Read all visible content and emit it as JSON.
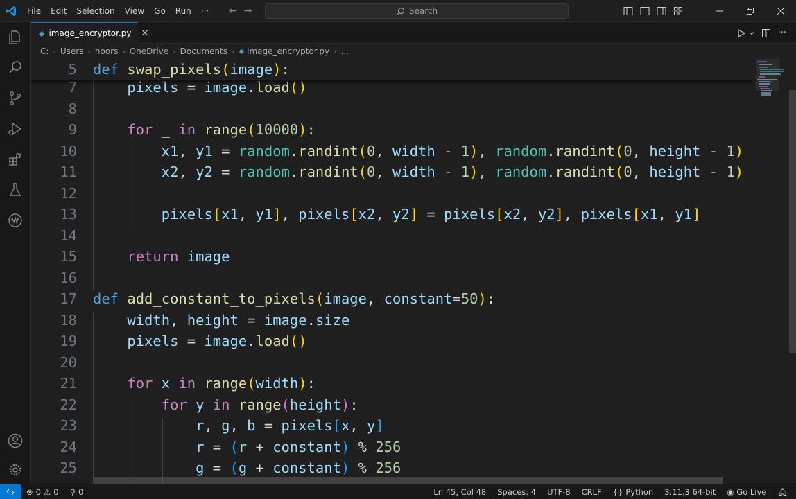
{
  "menu": [
    "File",
    "Edit",
    "Selection",
    "View",
    "Go",
    "Run",
    "···"
  ],
  "search": {
    "placeholder": "Search"
  },
  "tab": {
    "filename": "image_encryptor.py",
    "close": "✕"
  },
  "breadcrumb": [
    "C:",
    "Users",
    "noors",
    "OneDrive",
    "Documents",
    "image_encryptor.py",
    "..."
  ],
  "code_lines": [
    {
      "n": "5",
      "tokens": [
        [
          "kw",
          "def"
        ],
        [
          "op",
          " "
        ],
        [
          "fn",
          "swap_pixels"
        ],
        [
          "p1",
          "("
        ],
        [
          "var",
          "image"
        ],
        [
          "p1",
          ")"
        ],
        [
          "op",
          ":"
        ]
      ]
    },
    {
      "n": "7",
      "tokens": [
        [
          "op",
          "    "
        ],
        [
          "var",
          "pixels"
        ],
        [
          "op",
          " = "
        ],
        [
          "var",
          "image"
        ],
        [
          "op",
          "."
        ],
        [
          "fn",
          "load"
        ],
        [
          "p1",
          "()"
        ]
      ]
    },
    {
      "n": "8",
      "tokens": []
    },
    {
      "n": "9",
      "tokens": [
        [
          "op",
          "    "
        ],
        [
          "kw2",
          "for"
        ],
        [
          "op",
          " "
        ],
        [
          "var",
          "_"
        ],
        [
          "op",
          " "
        ],
        [
          "kw2",
          "in"
        ],
        [
          "op",
          " "
        ],
        [
          "fn",
          "range"
        ],
        [
          "p1",
          "("
        ],
        [
          "num",
          "10000"
        ],
        [
          "p1",
          ")"
        ],
        [
          "op",
          ":"
        ]
      ]
    },
    {
      "n": "10",
      "tokens": [
        [
          "op",
          "        "
        ],
        [
          "var",
          "x1"
        ],
        [
          "op",
          ", "
        ],
        [
          "var",
          "y1"
        ],
        [
          "op",
          " = "
        ],
        [
          "cls",
          "random"
        ],
        [
          "op",
          "."
        ],
        [
          "fn",
          "randint"
        ],
        [
          "p1",
          "("
        ],
        [
          "num",
          "0"
        ],
        [
          "op",
          ", "
        ],
        [
          "var",
          "width"
        ],
        [
          "op",
          " - "
        ],
        [
          "num",
          "1"
        ],
        [
          "p1",
          ")"
        ],
        [
          "op",
          ", "
        ],
        [
          "cls",
          "random"
        ],
        [
          "op",
          "."
        ],
        [
          "fn",
          "randint"
        ],
        [
          "p1",
          "("
        ],
        [
          "num",
          "0"
        ],
        [
          "op",
          ", "
        ],
        [
          "var",
          "height"
        ],
        [
          "op",
          " - "
        ],
        [
          "num",
          "1"
        ],
        [
          "p1",
          ")"
        ]
      ]
    },
    {
      "n": "11",
      "tokens": [
        [
          "op",
          "        "
        ],
        [
          "var",
          "x2"
        ],
        [
          "op",
          ", "
        ],
        [
          "var",
          "y2"
        ],
        [
          "op",
          " = "
        ],
        [
          "cls",
          "random"
        ],
        [
          "op",
          "."
        ],
        [
          "fn",
          "randint"
        ],
        [
          "p1",
          "("
        ],
        [
          "num",
          "0"
        ],
        [
          "op",
          ", "
        ],
        [
          "var",
          "width"
        ],
        [
          "op",
          " - "
        ],
        [
          "num",
          "1"
        ],
        [
          "p1",
          ")"
        ],
        [
          "op",
          ", "
        ],
        [
          "cls",
          "random"
        ],
        [
          "op",
          "."
        ],
        [
          "fn",
          "randint"
        ],
        [
          "p1",
          "("
        ],
        [
          "num",
          "0"
        ],
        [
          "op",
          ", "
        ],
        [
          "var",
          "height"
        ],
        [
          "op",
          " - "
        ],
        [
          "num",
          "1"
        ],
        [
          "p1",
          ")"
        ]
      ]
    },
    {
      "n": "12",
      "tokens": []
    },
    {
      "n": "13",
      "tokens": [
        [
          "op",
          "        "
        ],
        [
          "var",
          "pixels"
        ],
        [
          "p1",
          "["
        ],
        [
          "var",
          "x1"
        ],
        [
          "op",
          ", "
        ],
        [
          "var",
          "y1"
        ],
        [
          "p1",
          "]"
        ],
        [
          "op",
          ", "
        ],
        [
          "var",
          "pixels"
        ],
        [
          "p1",
          "["
        ],
        [
          "var",
          "x2"
        ],
        [
          "op",
          ", "
        ],
        [
          "var",
          "y2"
        ],
        [
          "p1",
          "]"
        ],
        [
          "op",
          " = "
        ],
        [
          "var",
          "pixels"
        ],
        [
          "p1",
          "["
        ],
        [
          "var",
          "x2"
        ],
        [
          "op",
          ", "
        ],
        [
          "var",
          "y2"
        ],
        [
          "p1",
          "]"
        ],
        [
          "op",
          ", "
        ],
        [
          "var",
          "pixels"
        ],
        [
          "p1",
          "["
        ],
        [
          "var",
          "x1"
        ],
        [
          "op",
          ", "
        ],
        [
          "var",
          "y1"
        ],
        [
          "p1",
          "]"
        ]
      ]
    },
    {
      "n": "14",
      "tokens": []
    },
    {
      "n": "15",
      "tokens": [
        [
          "op",
          "    "
        ],
        [
          "kw2",
          "return"
        ],
        [
          "op",
          " "
        ],
        [
          "var",
          "image"
        ]
      ]
    },
    {
      "n": "16",
      "tokens": []
    },
    {
      "n": "17",
      "tokens": [
        [
          "kw",
          "def"
        ],
        [
          "op",
          " "
        ],
        [
          "fn",
          "add_constant_to_pixels"
        ],
        [
          "p1",
          "("
        ],
        [
          "var",
          "image"
        ],
        [
          "op",
          ", "
        ],
        [
          "var",
          "constant"
        ],
        [
          "op",
          "="
        ],
        [
          "num",
          "50"
        ],
        [
          "p1",
          ")"
        ],
        [
          "op",
          ":"
        ]
      ]
    },
    {
      "n": "18",
      "tokens": [
        [
          "op",
          "    "
        ],
        [
          "var",
          "width"
        ],
        [
          "op",
          ", "
        ],
        [
          "var",
          "height"
        ],
        [
          "op",
          " = "
        ],
        [
          "var",
          "image"
        ],
        [
          "op",
          "."
        ],
        [
          "var",
          "size"
        ]
      ]
    },
    {
      "n": "19",
      "tokens": [
        [
          "op",
          "    "
        ],
        [
          "var",
          "pixels"
        ],
        [
          "op",
          " = "
        ],
        [
          "var",
          "image"
        ],
        [
          "op",
          "."
        ],
        [
          "fn",
          "load"
        ],
        [
          "p1",
          "()"
        ]
      ]
    },
    {
      "n": "20",
      "tokens": []
    },
    {
      "n": "21",
      "tokens": [
        [
          "op",
          "    "
        ],
        [
          "kw2",
          "for"
        ],
        [
          "op",
          " "
        ],
        [
          "var",
          "x"
        ],
        [
          "op",
          " "
        ],
        [
          "kw2",
          "in"
        ],
        [
          "op",
          " "
        ],
        [
          "fn",
          "range"
        ],
        [
          "p1",
          "("
        ],
        [
          "var",
          "width"
        ],
        [
          "p1",
          ")"
        ],
        [
          "op",
          ":"
        ]
      ]
    },
    {
      "n": "22",
      "tokens": [
        [
          "op",
          "        "
        ],
        [
          "kw2",
          "for"
        ],
        [
          "op",
          " "
        ],
        [
          "var",
          "y"
        ],
        [
          "op",
          " "
        ],
        [
          "kw2",
          "in"
        ],
        [
          "op",
          " "
        ],
        [
          "fn",
          "range"
        ],
        [
          "p2",
          "("
        ],
        [
          "var",
          "height"
        ],
        [
          "p2",
          ")"
        ],
        [
          "op",
          ":"
        ]
      ]
    },
    {
      "n": "23",
      "tokens": [
        [
          "op",
          "            "
        ],
        [
          "var",
          "r"
        ],
        [
          "op",
          ", "
        ],
        [
          "var",
          "g"
        ],
        [
          "op",
          ", "
        ],
        [
          "var",
          "b"
        ],
        [
          "op",
          " = "
        ],
        [
          "var",
          "pixels"
        ],
        [
          "p3",
          "["
        ],
        [
          "var",
          "x"
        ],
        [
          "op",
          ", "
        ],
        [
          "var",
          "y"
        ],
        [
          "p3",
          "]"
        ]
      ]
    },
    {
      "n": "24",
      "tokens": [
        [
          "op",
          "            "
        ],
        [
          "var",
          "r"
        ],
        [
          "op",
          " = "
        ],
        [
          "p3",
          "("
        ],
        [
          "var",
          "r"
        ],
        [
          "op",
          " + "
        ],
        [
          "var",
          "constant"
        ],
        [
          "p3",
          ")"
        ],
        [
          "op",
          " % "
        ],
        [
          "num",
          "256"
        ]
      ]
    },
    {
      "n": "25",
      "tokens": [
        [
          "op",
          "            "
        ],
        [
          "var",
          "g"
        ],
        [
          "op",
          " = "
        ],
        [
          "p3",
          "("
        ],
        [
          "var",
          "g"
        ],
        [
          "op",
          " + "
        ],
        [
          "var",
          "constant"
        ],
        [
          "p3",
          ")"
        ],
        [
          "op",
          " % "
        ],
        [
          "num",
          "256"
        ]
      ]
    }
  ],
  "status": {
    "errors": "0",
    "warnings": "0",
    "ports": "0",
    "position": "Ln 45, Col 48",
    "spaces": "Spaces: 4",
    "encoding": "UTF-8",
    "eol": "CRLF",
    "language": "Python",
    "interpreter": "3.11.3 64-bit",
    "golive": "Go Live"
  },
  "colors": {
    "accent": "#0078d4",
    "background": "#1f1f1f"
  }
}
